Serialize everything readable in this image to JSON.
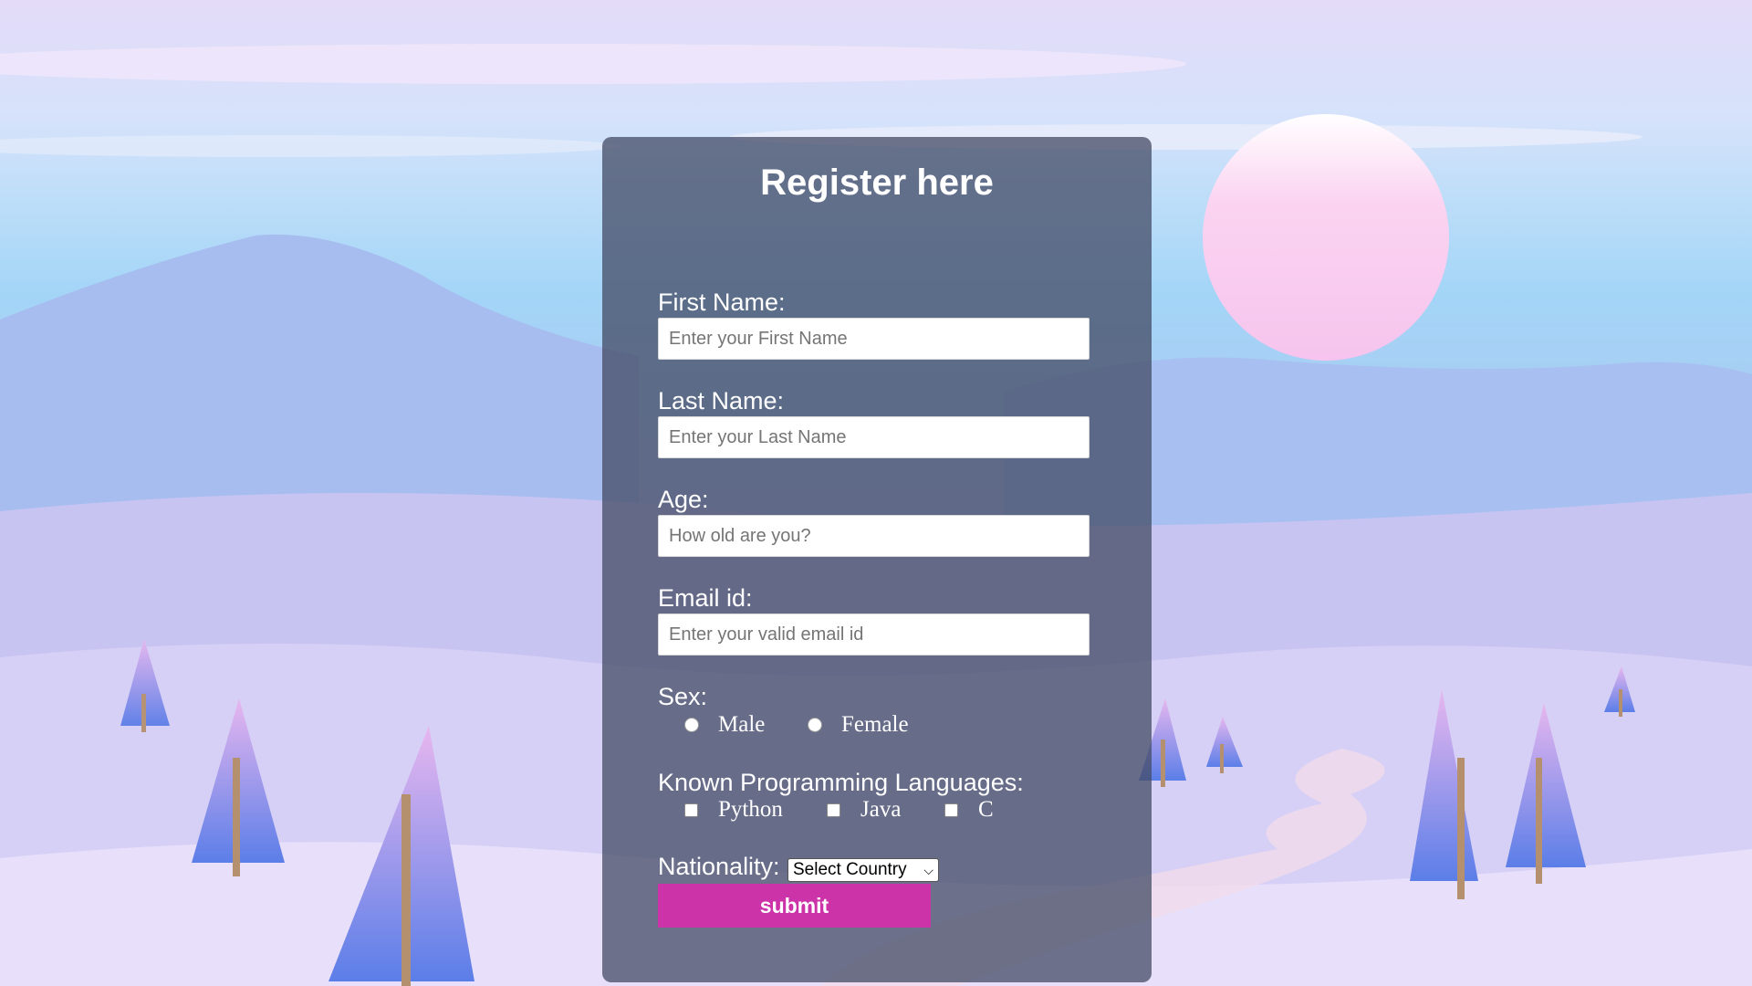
{
  "form": {
    "title": "Register here",
    "first_name": {
      "label": "First Name:",
      "placeholder": "Enter your First Name"
    },
    "last_name": {
      "label": "Last Name:",
      "placeholder": "Enter your Last Name"
    },
    "age": {
      "label": "Age:",
      "placeholder": "How old are you?"
    },
    "email": {
      "label": "Email id:",
      "placeholder": "Enter your valid email id"
    },
    "sex": {
      "label": "Sex:",
      "options": [
        "Male",
        "Female"
      ]
    },
    "languages": {
      "label": "Known Programming Languages:",
      "options": [
        "Python",
        "Java",
        "C"
      ]
    },
    "nationality": {
      "label": "Nationality:",
      "selected": "Select Country"
    },
    "submit_label": "submit"
  },
  "colors": {
    "submit_button": "#cc33a8",
    "card_overlay": "#444c66"
  }
}
